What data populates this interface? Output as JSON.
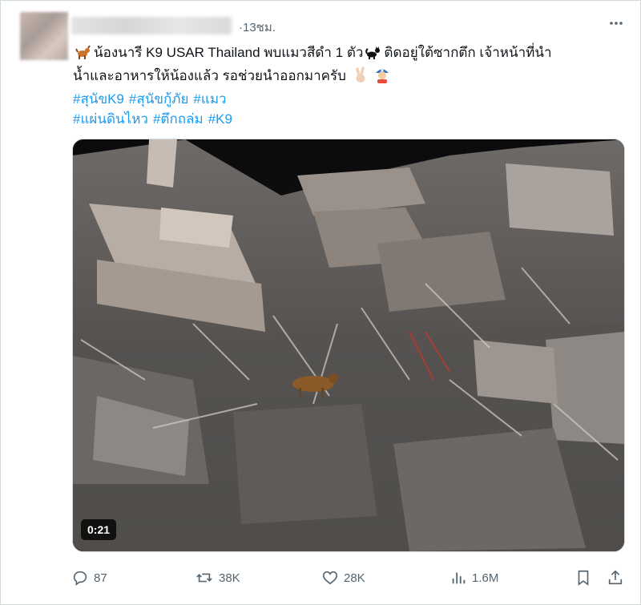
{
  "tweet": {
    "time": "·13ชม.",
    "text_line1": "น้องนารี K9 USAR Thailand พบแมวสีดำ 1 ตัว",
    "text_line1b": "ติดอยู่ใต้ซากตึก เจ้าหน้าที่นำ",
    "text_line2": "น้ำและอาหารให้น้องแล้ว รอช่วยนำออกมาครับ",
    "hashtags_line1": [
      "#สุนัขK9",
      "#สุนัขกู้ภัย",
      "#แมว"
    ],
    "hashtags_line2": [
      "#แผ่นดินไหว",
      "#ตึกถล่ม",
      "#K9"
    ]
  },
  "media": {
    "duration": "0:21"
  },
  "actions": {
    "replies": "87",
    "retweets": "38K",
    "likes": "28K",
    "views": "1.6M"
  },
  "colors": {
    "accent": "#1d9bf0",
    "muted": "#536471"
  }
}
